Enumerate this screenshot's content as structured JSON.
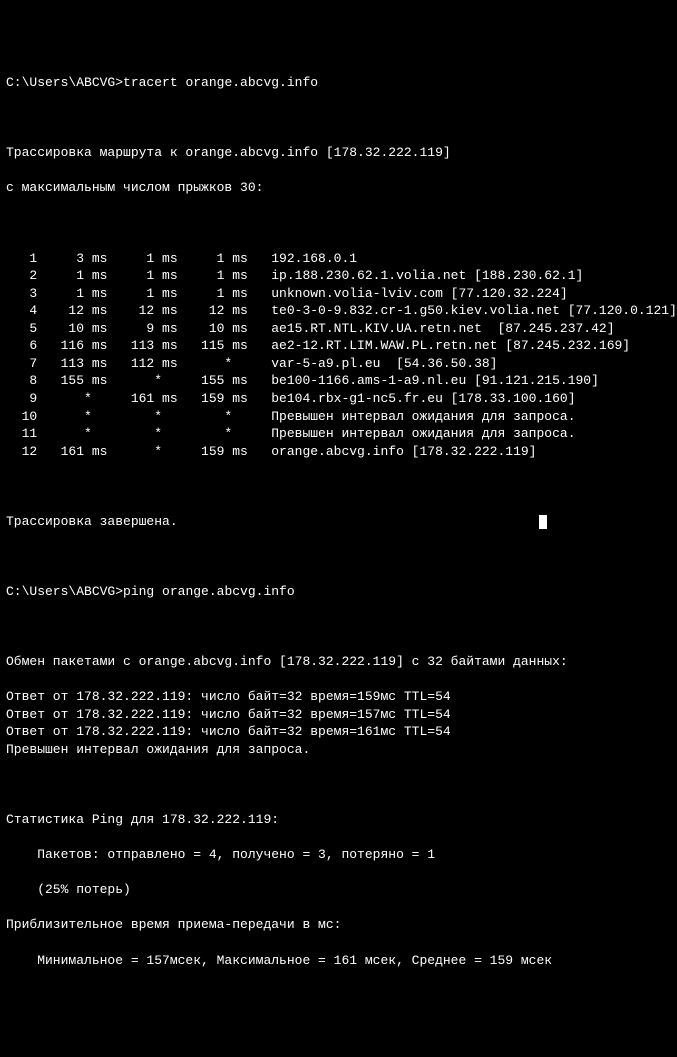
{
  "prompt1_path": "C:\\Users\\ABCVG>",
  "prompt1_cmd": "tracert orange.abcvg.info",
  "trace_header1": "Трассировка маршрута к orange.abcvg.info [178.32.222.119]",
  "trace_header2": "с максимальным числом прыжков 30:",
  "hops": [
    {
      "n": " 1",
      "t1": "   3 ms",
      "t2": "   1 ms",
      "t3": "   1 ms",
      "host": "192.168.0.1"
    },
    {
      "n": " 2",
      "t1": "   1 ms",
      "t2": "   1 ms",
      "t3": "   1 ms",
      "host": "ip.188.230.62.1.volia.net [188.230.62.1]"
    },
    {
      "n": " 3",
      "t1": "   1 ms",
      "t2": "   1 ms",
      "t3": "   1 ms",
      "host": "unknown.volia-lviv.com [77.120.32.224]"
    },
    {
      "n": " 4",
      "t1": "  12 ms",
      "t2": "  12 ms",
      "t3": "  12 ms",
      "host": "te0-3-0-9.832.cr-1.g50.kiev.volia.net [77.120.0.121]"
    },
    {
      "n": " 5",
      "t1": "  10 ms",
      "t2": "   9 ms",
      "t3": "  10 ms",
      "host": "ae15.RT.NTL.KIV.UA.retn.net  [87.245.237.42]"
    },
    {
      "n": " 6",
      "t1": " 116 ms",
      "t2": " 113 ms",
      "t3": " 115 ms",
      "host": "ae2-12.RT.LIM.WAW.PL.retn.net [87.245.232.169]"
    },
    {
      "n": " 7",
      "t1": " 113 ms",
      "t2": " 112 ms",
      "t3": "    *  ",
      "host": "var-5-a9.pl.eu  [54.36.50.38]"
    },
    {
      "n": " 8",
      "t1": " 155 ms",
      "t2": "    *  ",
      "t3": " 155 ms",
      "host": "be100-1166.ams-1-a9.nl.eu [91.121.215.190]"
    },
    {
      "n": " 9",
      "t1": "    *  ",
      "t2": " 161 ms",
      "t3": " 159 ms",
      "host": "be104.rbx-g1-nc5.fr.eu [178.33.100.160]"
    },
    {
      "n": "10",
      "t1": "    *  ",
      "t2": "    *  ",
      "t3": "    *  ",
      "host": "Превышен интервал ожидания для запроса."
    },
    {
      "n": "11",
      "t1": "    *  ",
      "t2": "    *  ",
      "t3": "    *  ",
      "host": "Превышен интервал ожидания для запроса."
    },
    {
      "n": "12",
      "t1": " 161 ms",
      "t2": "    *  ",
      "t3": " 159 ms",
      "host": "orange.abcvg.info [178.32.222.119]"
    }
  ],
  "trace_done": "Трассировка завершена.",
  "prompt2_path": "C:\\Users\\ABCVG>",
  "prompt2_cmd": "ping orange.abcvg.info",
  "ping_header": "Обмен пакетами с orange.abcvg.info [178.32.222.119] с 32 байтами данных:",
  "ping_replies": [
    "Ответ от 178.32.222.119: число байт=32 время=159мс TTL=54",
    "Ответ от 178.32.222.119: число байт=32 время=157мс TTL=54",
    "Ответ от 178.32.222.119: число байт=32 время=161мс TTL=54",
    "Превышен интервал ожидания для запроса."
  ],
  "ping_stats_header": "Статистика Ping для 178.32.222.119:",
  "ping_stats_packets": "    Пакетов: отправлено = 4, получено = 3, потеряно = 1",
  "ping_stats_loss": "    (25% потерь)",
  "ping_rtt_header": "Приблизительное время приема-передачи в мс:",
  "ping_rtt_values": "    Минимальное = 157мсек, Максимальное = 161 мсек, Среднее = 159 мсек"
}
